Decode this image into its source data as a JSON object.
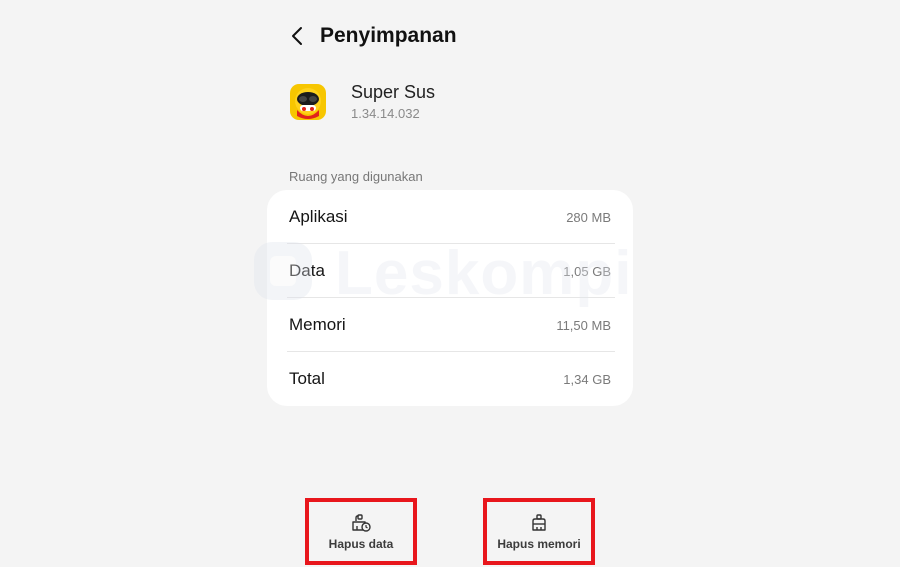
{
  "header": {
    "title": "Penyimpanan",
    "back_icon": "chevron-left-icon"
  },
  "app": {
    "name": "Super Sus",
    "version": "1.34.14.032",
    "icon": "super-sus-app-icon"
  },
  "storage": {
    "section_label": "Ruang yang digunakan",
    "rows": [
      {
        "label": "Aplikasi",
        "value": "280 MB"
      },
      {
        "label": "Data",
        "value": "1,05 GB"
      },
      {
        "label": "Memori",
        "value": "11,50 MB"
      },
      {
        "label": "Total",
        "value": "1,34 GB"
      }
    ]
  },
  "watermark": {
    "text": "Leskompi"
  },
  "actions": {
    "clear_data_label": "Hapus data",
    "clear_cache_label": "Hapus memori"
  },
  "colors": {
    "background": "#f4f4f4",
    "card": "#ffffff",
    "highlight": "#e8161c"
  }
}
